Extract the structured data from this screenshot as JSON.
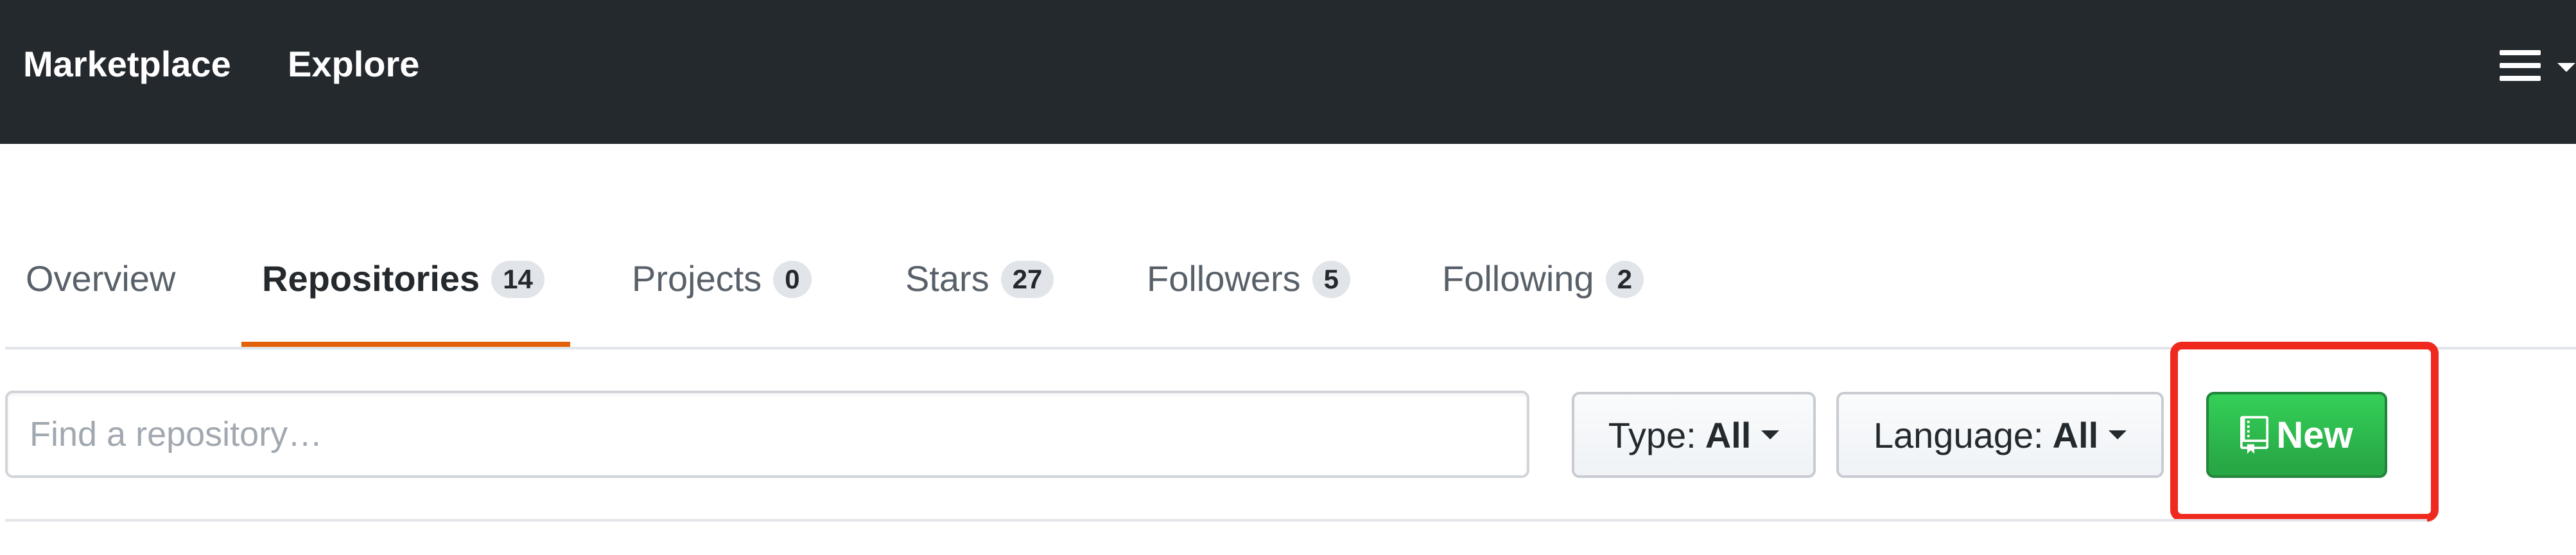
{
  "header": {
    "nav": [
      "Marketplace",
      "Explore"
    ],
    "menu_icon": "hamburger-menu-icon"
  },
  "tabs": [
    {
      "label": "Overview",
      "count": null,
      "selected": false
    },
    {
      "label": "Repositories",
      "count": "14",
      "selected": true
    },
    {
      "label": "Projects",
      "count": "0",
      "selected": false
    },
    {
      "label": "Stars",
      "count": "27",
      "selected": false
    },
    {
      "label": "Followers",
      "count": "5",
      "selected": false
    },
    {
      "label": "Following",
      "count": "2",
      "selected": false
    }
  ],
  "filters": {
    "search_placeholder": "Find a repository…",
    "search_value": "",
    "type": {
      "prefix": "Type:",
      "value": "All"
    },
    "language": {
      "prefix": "Language:",
      "value": "All"
    },
    "new_button": {
      "label": "New",
      "icon": "repo-icon"
    }
  },
  "colors": {
    "header_bg": "#24292e",
    "selected_tab_underline": "#e36209",
    "new_button": "#28a745",
    "highlight": "#f0291e"
  }
}
